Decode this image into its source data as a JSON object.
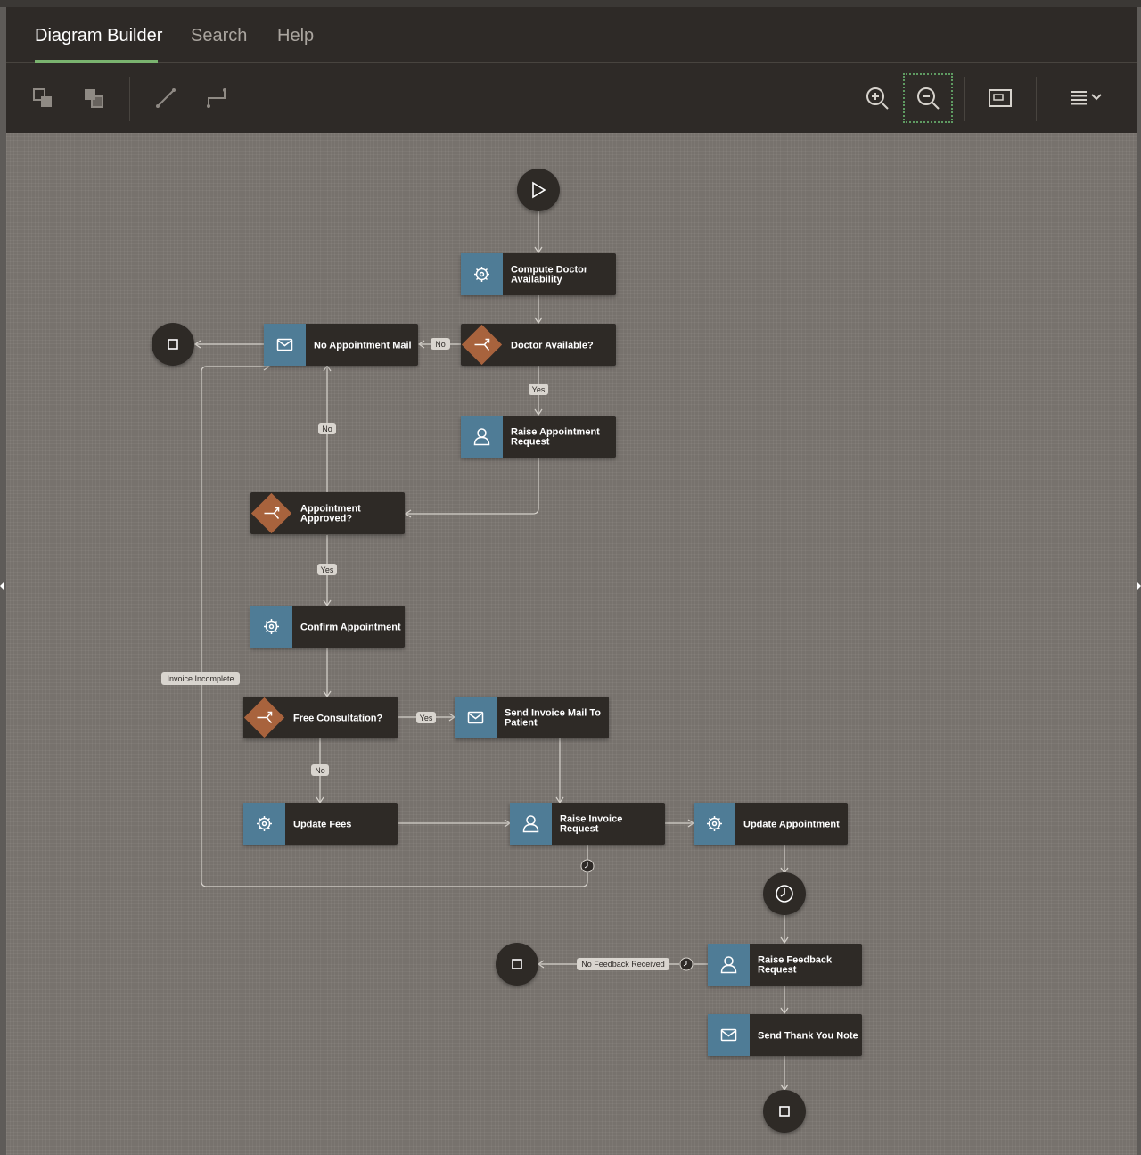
{
  "tabs": [
    {
      "label": "Diagram Builder",
      "active": true
    },
    {
      "label": "Search",
      "active": false
    },
    {
      "label": "Help",
      "active": false
    }
  ],
  "toolbar": {
    "left_buttons": [
      "bring-to-front-icon",
      "send-to-back-icon",
      "straight-line-icon",
      "elbow-line-icon"
    ],
    "right_buttons": [
      "zoom-in-icon",
      "zoom-out-icon",
      "fit-to-window-icon",
      "menu-icon"
    ]
  },
  "nodes": {
    "compute": {
      "type": "service",
      "lines": [
        "Compute Doctor",
        "Availability"
      ]
    },
    "doctor_available": {
      "type": "gateway",
      "lines": [
        "Doctor Available?"
      ]
    },
    "no_appt_mail": {
      "type": "mail",
      "lines": [
        "No Appointment Mail"
      ]
    },
    "raise_appt": {
      "type": "user",
      "lines": [
        "Raise Appointment",
        "Request"
      ]
    },
    "appt_approved": {
      "type": "gateway",
      "lines": [
        "Appointment",
        "Approved?"
      ]
    },
    "confirm_appt": {
      "type": "service",
      "lines": [
        "Confirm Appointment"
      ]
    },
    "free_consult": {
      "type": "gateway",
      "lines": [
        "Free Consultation?"
      ]
    },
    "send_invoice": {
      "type": "mail",
      "lines": [
        "Send Invoice Mail To",
        "Patient"
      ]
    },
    "update_fees": {
      "type": "service",
      "lines": [
        "Update Fees"
      ]
    },
    "raise_invoice": {
      "type": "user",
      "lines": [
        "Raise Invoice",
        "Request"
      ]
    },
    "update_appt": {
      "type": "service",
      "lines": [
        "Update Appointment"
      ]
    },
    "raise_feedback": {
      "type": "user",
      "lines": [
        "Raise Feedback",
        "Request"
      ]
    },
    "thank_you": {
      "type": "mail",
      "lines": [
        "Send Thank You Note"
      ]
    }
  },
  "edge_labels": {
    "no1": "No",
    "yes1": "Yes",
    "no2": "No",
    "yes2": "Yes",
    "yes3": "Yes",
    "no3": "No",
    "invoice_incomplete": "Invoice Incomplete",
    "no_feedback": "No Feedback Received"
  },
  "colors": {
    "task_dark": "#2e2a27",
    "task_icon_blue": "#4f7b96",
    "gateway_orange": "#a8633d",
    "edge": "#d6d2cc",
    "accent_green": "#7ab36f"
  }
}
